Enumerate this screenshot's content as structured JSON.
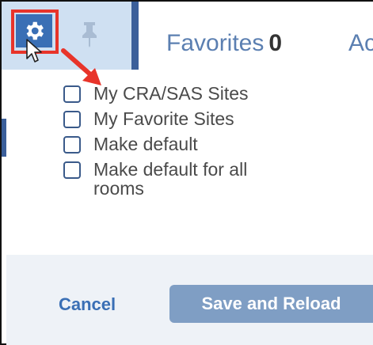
{
  "tabs": {
    "favorites_label": "Favorites",
    "favorites_count": "0",
    "next_tab_label": "Ac"
  },
  "options": [
    {
      "label": "My CRA/SAS Sites",
      "checked": false
    },
    {
      "label": "My Favorite Sites",
      "checked": false
    },
    {
      "label": "Make default",
      "checked": false
    },
    {
      "label": "Make default for all rooms",
      "checked": false
    }
  ],
  "footer": {
    "cancel_label": "Cancel",
    "save_label": "Save and Reload"
  },
  "icons": {
    "settings": "gear-icon",
    "pin": "pin-icon",
    "cursor": "mouse-cursor-icon",
    "annotation": "red-arrow-icon"
  },
  "colors": {
    "accent": "#3a6fb5",
    "highlight": "#e8342a",
    "save_button": "#7f9ec4"
  }
}
